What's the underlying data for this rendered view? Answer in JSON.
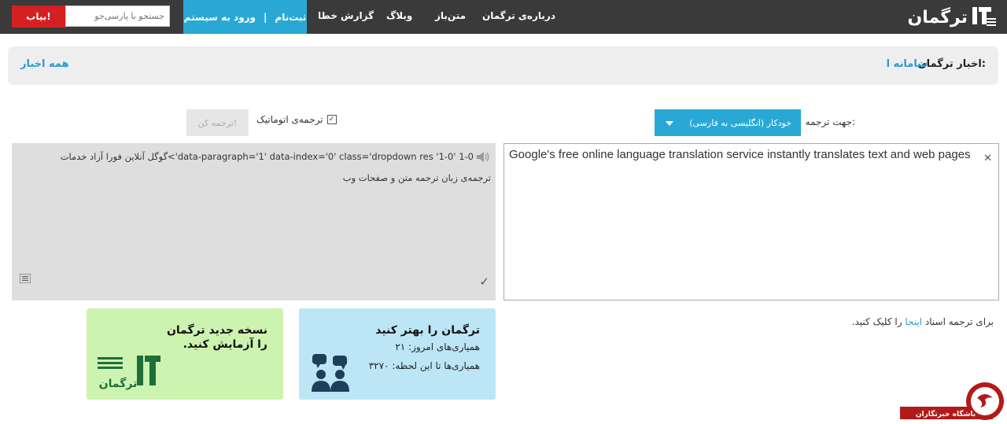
{
  "brand": {
    "logo_text": "ترگمان"
  },
  "nav": {
    "items": [
      {
        "label": "درباره‌ی ترگمان"
      },
      {
        "label": "متن‌باز"
      },
      {
        "label": "وبلاگ"
      },
      {
        "label": "گزارش خطا"
      }
    ],
    "signup_label": "ثبت‌نام",
    "separator": "|",
    "login_label": "ورود به سیستم",
    "search_placeholder": "جستجو با پارسی‌جو",
    "search_button": "بیاب!"
  },
  "news": {
    "title": "اخبار ترگمان:",
    "link": "سامانه ا",
    "all_link": "همه اخبار"
  },
  "translator": {
    "direction_label": "جهت ترجمه:",
    "direction_value": "خودکار (انگلیسی به فارسی)",
    "auto_label": "ترجمه‌ی اتوماتیک",
    "translate_button": "ترجمه کن!",
    "source_text": "Google's free online language translation service instantly translates text and web pages",
    "output_line1": "1-0 '1-0' data-paragraph='1' data-index='0' class='dropdown res'>گوگل آنلاین فورا آزاد خدمات",
    "output_line2": "ترجمه‌ی زبان ترجمه متن و صفحات وب",
    "doc_note_prefix": "برای ترجمه اسناد",
    "doc_note_link": "اینجا",
    "doc_note_suffix": "را کلیک کنید."
  },
  "improve_card": {
    "title": "ترگمان را بهتر کنید",
    "line1": "همیاری‌های امروز: ۲۱",
    "line2": "همیاری‌ها تا این لحظه: ۳۲۷۰"
  },
  "newver_card": {
    "title": "نسخه جدید ترگمان",
    "subtitle": "را آزمایش کنید.",
    "logo_text": "ترگمان"
  },
  "watermark": {
    "label": "باشگاه خبرنگاران"
  },
  "colors": {
    "accent": "#29a8d6",
    "danger": "#d42020",
    "navbar": "#3a3a3a",
    "link": "#2a9bd2",
    "green_card": "#cdf3b0",
    "blue_card": "#bce6f5"
  }
}
